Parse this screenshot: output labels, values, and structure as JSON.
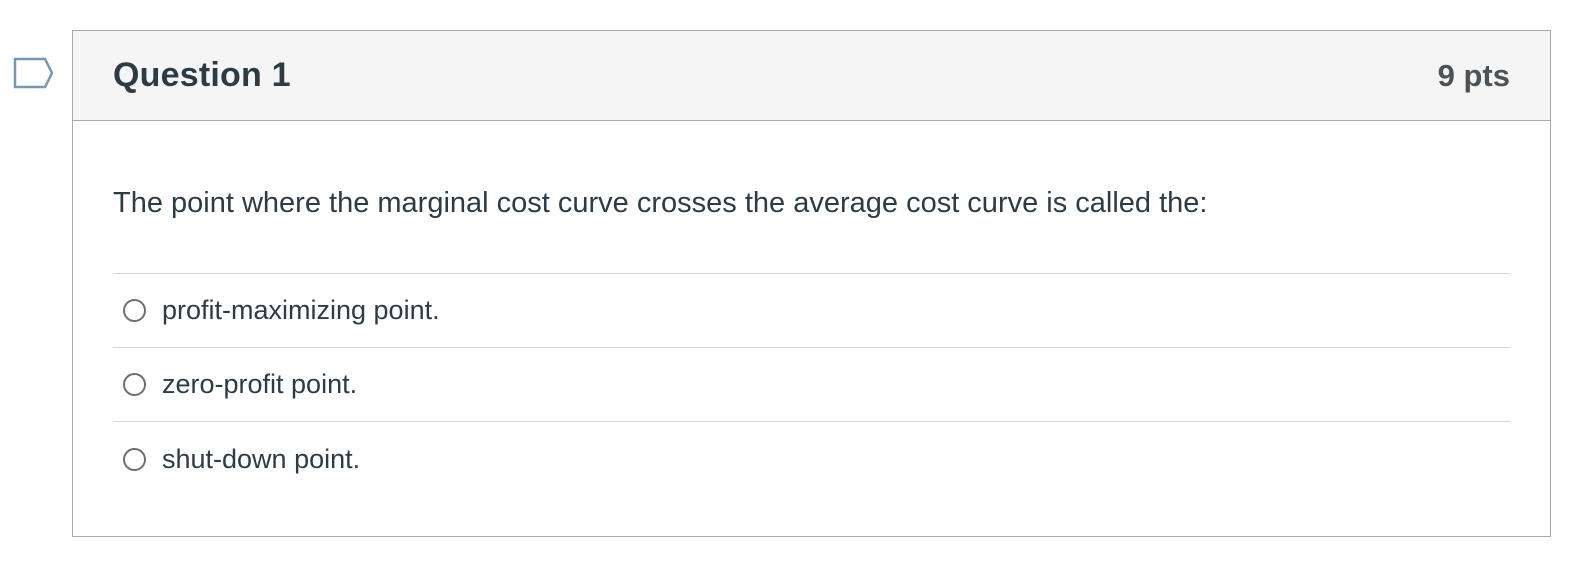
{
  "question": {
    "title": "Question 1",
    "points": "9 pts",
    "text": "The point where the marginal cost curve crosses the average cost curve is called the:",
    "answers": [
      {
        "label": "profit-maximizing point."
      },
      {
        "label": "zero-profit point."
      },
      {
        "label": "shut-down point."
      }
    ]
  },
  "icons": {
    "flag": "flag-question-icon"
  },
  "colors": {
    "text": "#2d3b45",
    "header_bg": "#f5f5f5",
    "border": "#aaaaaa",
    "flag_stroke": "#7a97ad"
  }
}
